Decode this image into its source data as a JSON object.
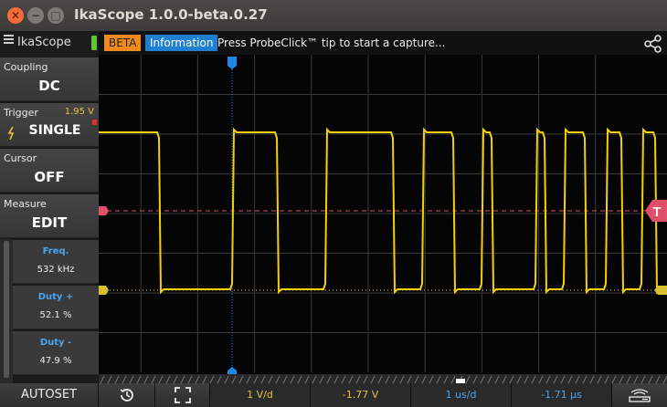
{
  "window": {
    "title": "IkaScope 1.0.0-beta.0.27",
    "close_glyph": "✕",
    "minimize_glyph": "−",
    "maximize_glyph": "□"
  },
  "toolbar": {
    "menu_label": "IkaScope",
    "beta_label": "BETA",
    "info_label": "Information",
    "status_text": "Press ProbeClick™ tip to start a capture...",
    "share_icon": "share-icon"
  },
  "sidebar": {
    "coupling": {
      "label": "Coupling",
      "value": "DC"
    },
    "trigger": {
      "label": "Trigger",
      "value": "SINGLE",
      "level": "1.95 V"
    },
    "cursor": {
      "label": "Cursor",
      "value": "OFF"
    },
    "measure": {
      "label": "Measure",
      "value": "EDIT"
    },
    "measurements": [
      {
        "label": "Freq.",
        "value": "532 kHz"
      },
      {
        "label": "Duty +",
        "value": "52.1 %"
      },
      {
        "label": "Duty -",
        "value": "47.9 %"
      }
    ]
  },
  "scope": {
    "trigger_marker_label": "T",
    "colors": {
      "trace": "#f5d000",
      "trigger_line": "#e0506a",
      "cursor": "#1e88e5",
      "grid": "#3a3a3a"
    }
  },
  "bottombar": {
    "autoset_label": "AUTOSET",
    "history_icon": "history-icon",
    "fullscreen_icon": "fullscreen-icon",
    "volts_per_div": "1 V/d",
    "vertical_offset": "-1.77 V",
    "time_per_div": "1 us/d",
    "time_offset": "-1.71 µs",
    "probe_icon": "probe-icon"
  }
}
